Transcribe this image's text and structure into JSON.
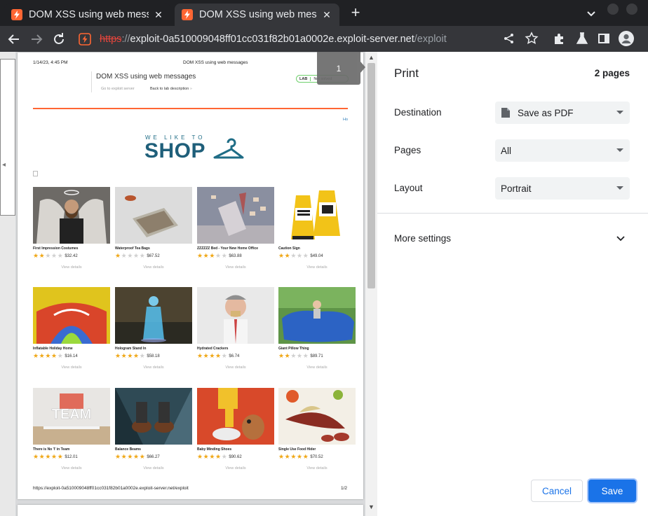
{
  "browser": {
    "tabs": [
      {
        "title": "DOM XSS using web messages",
        "close": "✕"
      },
      {
        "title": "DOM XSS using web messages",
        "close": "✕"
      }
    ],
    "new_tab": "+",
    "url": {
      "scheme": "https",
      "sep": "://",
      "host": "exploit-0a510009048ff01cc031f82b01a0002e.exploit-server.net",
      "path": "/exploit"
    }
  },
  "preview": {
    "page_number_badge": "1",
    "header_date": "1/14/23, 4:45 PM",
    "header_title": "DOM XSS using web messages",
    "lab_title": "DOM XSS using web messages",
    "link_exploit": "Go to exploit server",
    "link_back": "Back to lab description",
    "link_back_chevrons": "»",
    "badge_left": "LAB",
    "badge_right": "Not solved",
    "home_link": "Ho",
    "logo_small": "WE LIKE TO",
    "logo_big": "SHOP",
    "products": [
      {
        "name": "First Impression Costumes",
        "price": "$32.42",
        "rating": 2,
        "view": "View details"
      },
      {
        "name": "Waterproof Tea Bags",
        "price": "$67.52",
        "rating": 1,
        "view": "View details"
      },
      {
        "name": "ZZZZZZ Bed - Your New Home Office",
        "price": "$63.88",
        "rating": 3,
        "view": "View details"
      },
      {
        "name": "Caution Sign",
        "price": "$49.04",
        "rating": 2,
        "view": "View details"
      },
      {
        "name": "Inflatable Holiday Home",
        "price": "$16.14",
        "rating": 4,
        "view": "View details"
      },
      {
        "name": "Hologram Stand In",
        "price": "$58.18",
        "rating": 4,
        "view": "View details"
      },
      {
        "name": "Hydrated Crackers",
        "price": "$6.74",
        "rating": 4,
        "view": "View details"
      },
      {
        "name": "Giant Pillow Thing",
        "price": "$89.71",
        "rating": 2,
        "view": "View details"
      },
      {
        "name": "There is No 'I' in Team",
        "price": "$12.01",
        "rating": 5,
        "view": "View details"
      },
      {
        "name": "Balance Beams",
        "price": "$66.27",
        "rating": 5,
        "view": "View details"
      },
      {
        "name": "Baby Minding Shoes",
        "price": "$90.62",
        "rating": 4,
        "view": "View details"
      },
      {
        "name": "Single Use Food Hider",
        "price": "$70.52",
        "rating": 5,
        "view": "View details"
      }
    ],
    "footer_url": "https://exploit-0a510009048ff01cc031f82b01a0002e.exploit-server.net/exploit",
    "footer_page": "1/2",
    "team_sign_text": "TEAM"
  },
  "print": {
    "title": "Print",
    "sheet_count": "2 pages",
    "destination_label": "Destination",
    "destination_value": "Save as PDF",
    "pages_label": "Pages",
    "pages_value": "All",
    "layout_label": "Layout",
    "layout_value": "Portrait",
    "more_settings": "More settings",
    "cancel": "Cancel",
    "save": "Save"
  },
  "colors": {
    "accent": "#1a73e8",
    "brand_orange": "#ff6633",
    "star_filled": "#f0a818",
    "star_empty": "#d0d0d0"
  }
}
